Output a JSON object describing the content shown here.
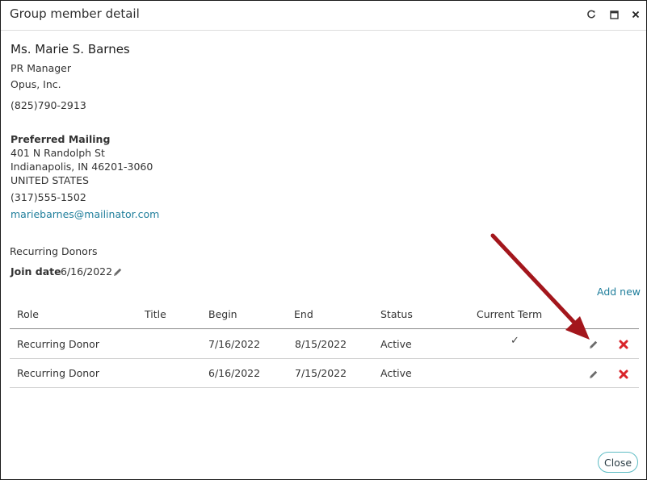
{
  "window": {
    "title": "Group member detail",
    "icons": [
      "refresh-icon",
      "maximize-icon",
      "close-icon"
    ]
  },
  "member": {
    "name": "Ms. Marie S. Barnes",
    "job_title": "PR Manager",
    "organization": "Opus, Inc.",
    "phone": "(825)790-2913"
  },
  "mailing": {
    "heading": "Preferred Mailing",
    "street": "401 N Randolph St",
    "city_line": "Indianapolis, IN 46201-3060",
    "country": "UNITED STATES",
    "phone": "(317)555-1502",
    "email": "mariebarnes@mailinator.com"
  },
  "group": {
    "name": "Recurring Donors",
    "join_date_label": "Join date",
    "join_date": "6/16/2022",
    "add_new": "Add new"
  },
  "table": {
    "headers": {
      "role": "Role",
      "title": "Title",
      "begin": "Begin",
      "end": "End",
      "status": "Status",
      "current_term": "Current Term"
    },
    "rows": [
      {
        "role": "Recurring Donor",
        "title": "",
        "begin": "7/16/2022",
        "end": "8/15/2022",
        "status": "Active",
        "current_term": "✓"
      },
      {
        "role": "Recurring Donor",
        "title": "",
        "begin": "6/16/2022",
        "end": "7/15/2022",
        "status": "Active",
        "current_term": ""
      }
    ]
  },
  "footer": {
    "close_label": "Close"
  },
  "colors": {
    "link": "#1f7e9b",
    "delete": "#d9252b",
    "arrow": "#a3161c",
    "close_border": "#5fbcc4"
  }
}
